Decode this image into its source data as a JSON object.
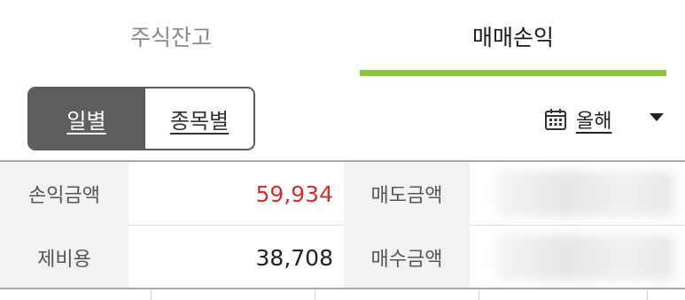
{
  "tabs": [
    {
      "label": "주식잔고",
      "active": false
    },
    {
      "label": "매매손익",
      "active": true
    }
  ],
  "accent_color": "#8dc63f",
  "segment": {
    "daily_label": "일별",
    "by_stock_label": "종목별",
    "selected": "일별"
  },
  "period": {
    "icon": "calendar-icon",
    "label": "올해",
    "dropdown_icon": "caret-down-icon"
  },
  "summary": {
    "row1": {
      "label_a": "손익금액",
      "value_a": "59,934",
      "label_b": "매도금액",
      "value_b": ""
    },
    "row2": {
      "label_a": "제비용",
      "value_a": "38,708",
      "label_b": "매수금액",
      "value_b": ""
    }
  },
  "profit_color": "#d32f2f"
}
